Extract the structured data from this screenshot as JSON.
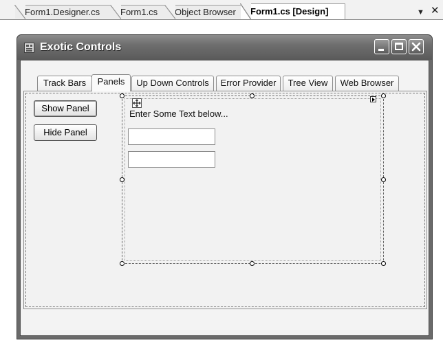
{
  "document_tabs": {
    "tabs": [
      {
        "label": "Form1.Designer.cs",
        "active": false
      },
      {
        "label": "Form1.cs",
        "active": false
      },
      {
        "label": "Object Browser",
        "active": false
      },
      {
        "label": "Form1.cs [Design]",
        "active": true
      }
    ],
    "dropdown_icon": "chevron-down-icon",
    "close_icon": "close-icon"
  },
  "form": {
    "title": "Exotic Controls",
    "app_icon": "form-icon",
    "window_buttons": [
      "minimize-icon",
      "maximize-icon",
      "close-icon"
    ],
    "tabs": [
      {
        "label": "Track Bars",
        "active": false
      },
      {
        "label": "Panels",
        "active": true
      },
      {
        "label": "Up Down Controls",
        "active": false
      },
      {
        "label": "Error Provider",
        "active": false
      },
      {
        "label": "Tree View",
        "active": false
      },
      {
        "label": "Web Browser",
        "active": false
      }
    ],
    "buttons": {
      "show_panel": "Show Panel",
      "hide_panel": "Hide Panel"
    },
    "panel": {
      "label": "Enter Some Text below...",
      "textbox1_value": "",
      "textbox2_value": "",
      "move_icon": "move-icon",
      "smart_tag_icon": "smart-tag-arrow-icon"
    }
  },
  "colors": {
    "titlebar": "#6e6e6e",
    "client_background": "#f3f3f3"
  }
}
